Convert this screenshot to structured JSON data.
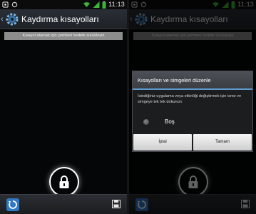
{
  "status_bar": {
    "time": "11:13"
  },
  "action_bar": {
    "title": "Kaydırma kısayolları"
  },
  "hint": "Kısayol atamak için çemberi hedefe sürükleyin",
  "dialog": {
    "title": "Kısayolları ve simgeleri düzenle",
    "message": "İstediğiniz uygulama veya etkinliği değiştirmek için isme ve simgeye tek tek dokunun",
    "option_label": "Boş",
    "cancel_label": "İptal",
    "ok_label": "Tamam"
  },
  "icons": {
    "back": "back-chevron-icon",
    "settings": "gear-icon",
    "lock": "lock-icon",
    "reset": "reset-icon",
    "save": "save-icon"
  },
  "colors": {
    "accent": "#5d9bcf",
    "bar_bg": "#2a2f36",
    "hint_bg": "#8c8c8c"
  }
}
